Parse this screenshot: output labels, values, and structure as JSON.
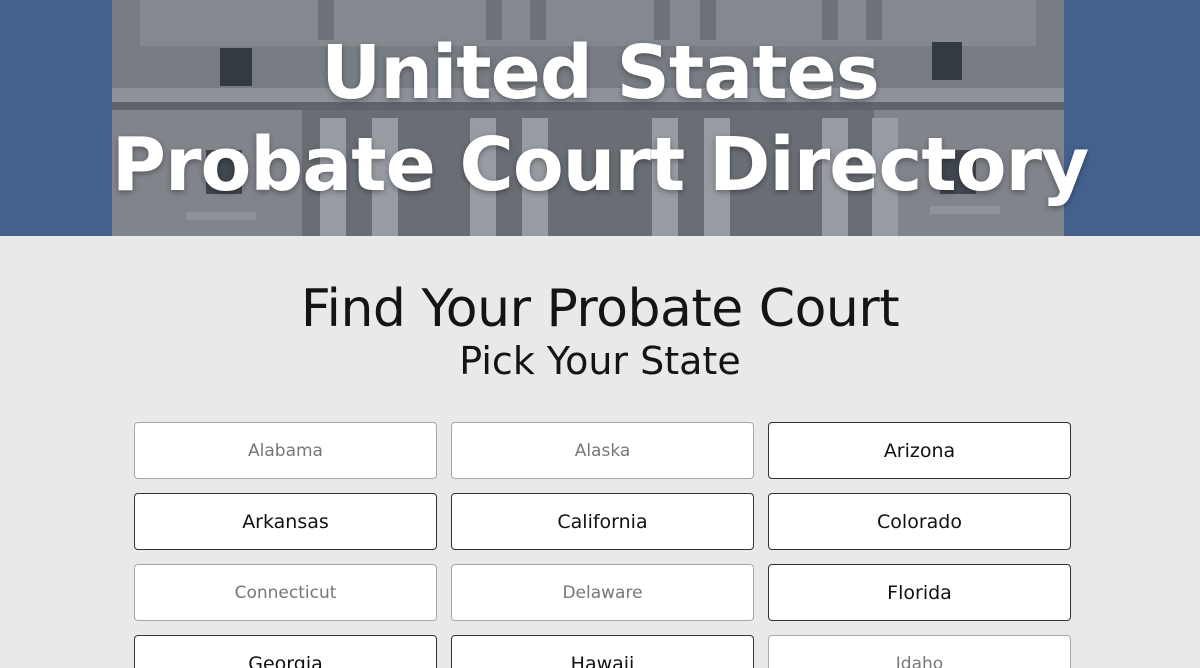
{
  "hero": {
    "title_line1": "United States",
    "title_line2": "Probate Court Directory"
  },
  "main": {
    "heading": "Find Your Probate Court",
    "subheading": "Pick Your State"
  },
  "states": [
    {
      "label": "Alabama",
      "muted": true
    },
    {
      "label": "Alaska",
      "muted": true
    },
    {
      "label": "Arizona",
      "muted": false
    },
    {
      "label": "Arkansas",
      "muted": false
    },
    {
      "label": "California",
      "muted": false
    },
    {
      "label": "Colorado",
      "muted": false
    },
    {
      "label": "Connecticut",
      "muted": true
    },
    {
      "label": "Delaware",
      "muted": true
    },
    {
      "label": "Florida",
      "muted": false
    },
    {
      "label": "Georgia",
      "muted": false
    },
    {
      "label": "Hawaii",
      "muted": false
    },
    {
      "label": "Idaho",
      "muted": true
    }
  ],
  "colors": {
    "sky": "#4f6fa0",
    "page_background": "#e9e9e9",
    "active_text": "#111111",
    "muted_text": "#777777"
  }
}
